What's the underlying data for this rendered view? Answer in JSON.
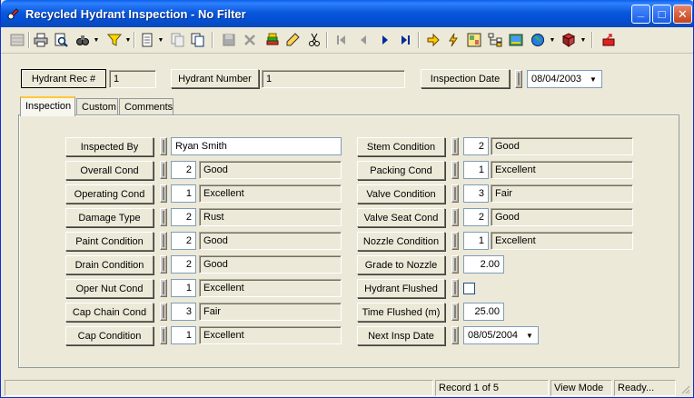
{
  "window": {
    "title": "Recycled Hydrant Inspection - No Filter",
    "minimize_glyph": "_",
    "maximize_glyph": "□",
    "close_glyph": "✕"
  },
  "toolbar": {
    "icons": [
      "grid-icon",
      "print-icon",
      "print-preview-icon",
      "find-icon",
      "filter-icon",
      "new-record-icon",
      "copy-record-icon",
      "paste-record-icon",
      "save-icon",
      "delete-icon",
      "edit-layers-icon",
      "edit-icon",
      "cut-icon",
      "first-record-icon",
      "previous-record-icon",
      "next-record-icon",
      "last-record-icon",
      "goto-arrow-icon",
      "lightning-icon",
      "map-icon",
      "tree-icon",
      "image-icon",
      "globe-icon",
      "book-icon",
      "exit-icon"
    ]
  },
  "header": {
    "rec_label": "Hydrant Rec #",
    "rec_value": "1",
    "number_label": "Hydrant Number",
    "number_value": "1",
    "date_label": "Inspection Date",
    "date_value": "08/04/2003"
  },
  "tabs": [
    {
      "label": "Inspection",
      "active": true
    },
    {
      "label": "Custom",
      "active": false
    },
    {
      "label": "Comments",
      "active": false
    }
  ],
  "left_fields": [
    {
      "label": "Inspected By",
      "value": "Ryan Smith"
    },
    {
      "label": "Overall Cond",
      "code": "2",
      "value": "Good"
    },
    {
      "label": "Operating Cond",
      "code": "1",
      "value": "Excellent"
    },
    {
      "label": "Damage Type",
      "code": "2",
      "value": "Rust"
    },
    {
      "label": "Paint Condition",
      "code": "2",
      "value": "Good"
    },
    {
      "label": "Drain Condition",
      "code": "2",
      "value": "Good"
    },
    {
      "label": "Oper Nut Cond",
      "code": "1",
      "value": "Excellent"
    },
    {
      "label": "Cap Chain Cond",
      "code": "3",
      "value": "Fair"
    },
    {
      "label": "Cap Condition",
      "code": "1",
      "value": "Excellent"
    }
  ],
  "right_fields": [
    {
      "label": "Stem Condition",
      "code": "2",
      "value": "Good"
    },
    {
      "label": "Packing Cond",
      "code": "1",
      "value": "Excellent"
    },
    {
      "label": "Valve Condition",
      "code": "3",
      "value": "Fair"
    },
    {
      "label": "Valve Seat Cond",
      "code": "2",
      "value": "Good"
    },
    {
      "label": "Nozzle Condition",
      "code": "1",
      "value": "Excellent"
    },
    {
      "label": "Grade to Nozzle",
      "value": "2.00"
    },
    {
      "label": "Hydrant Flushed",
      "checked": false
    },
    {
      "label": "Time Flushed (m)",
      "value": "25.00"
    },
    {
      "label": "Next Insp Date",
      "value": "08/05/2004"
    }
  ],
  "status": {
    "record": "Record 1 of 5",
    "mode": "View Mode",
    "state": "Ready..."
  },
  "colors": {
    "titlebar": "#0a59dd",
    "window_bg": "#ece9d8",
    "input_border": "#7f9db9",
    "tab_highlight": "#ffc83c"
  }
}
